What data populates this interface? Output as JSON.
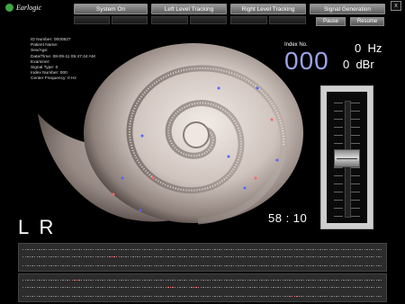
{
  "app": {
    "logo_text": "Earlogic",
    "close_glyph": "x"
  },
  "toolbar": {
    "system_on": "System On",
    "left_tracking": "Left Level Tracking",
    "right_tracking": "Right Level Tracking",
    "signal_generation": "Signal Generation",
    "pause": "Pause",
    "resume": "Resume"
  },
  "patient_info": [
    "ID Number: 0000827",
    "Patient Name:",
    "Sex/Age:",
    "Date/Time: 08-09-11 05:47:44 AM",
    "Examiner:",
    "Signal Type: 0",
    "Index Number: 000",
    "Center Frequency: 0 Hz"
  ],
  "readout": {
    "index_label": "Index No.",
    "index_value": "000",
    "frequency": "0  Hz",
    "level": "0  dBr",
    "timer": "58 : 10",
    "channels": "L R"
  },
  "colors": {
    "index_value": "#9aa3e8",
    "button_gradient_top": "#9a9a9a",
    "button_gradient_bottom": "#5e5e5e",
    "strip_background": "#2c2c2c",
    "logo_green": "#3fa646"
  },
  "icons": [
    "earlogic-logo-icon",
    "close-icon",
    "cochlea-image"
  ]
}
